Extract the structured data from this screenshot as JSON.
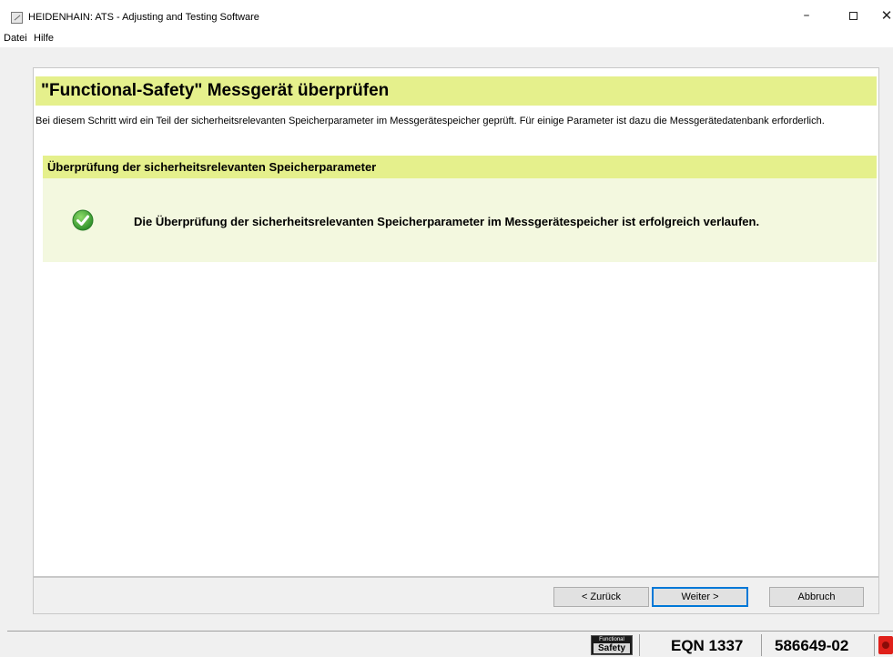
{
  "window": {
    "title": "HEIDENHAIN: ATS - Adjusting and Testing Software",
    "controls": {
      "minimize": "–",
      "close": "✕"
    }
  },
  "menu": {
    "datei": "Datei",
    "hilfe": "Hilfe"
  },
  "page": {
    "title": "\"Functional-Safety\" Messgerät überprüfen",
    "description": "Bei diesem Schritt wird ein Teil der sicherheitsrelevanten Speicherparameter im Messgerätespeicher geprüft. Für einige Parameter ist dazu die Messgerätedatenbank erforderlich.",
    "section_title": "Überprüfung der sicherheitsrelevanten Speicherparameter",
    "result_text": "Die Überprüfung der sicherheitsrelevanten Speicherparameter im Messgerätespeicher ist erfolgreich verlaufen.",
    "result_icon": "success-check-icon"
  },
  "buttons": {
    "back": "< Zurück",
    "next": "Weiter >",
    "cancel": "Abbruch"
  },
  "status": {
    "fs_logo_top": "Functional",
    "fs_logo_bottom": "Safety",
    "device": "EQN 1337",
    "id_number": "586649-02",
    "connection_icon": "red-status-indicator-icon"
  },
  "colors": {
    "header_bg": "#e5f08c",
    "result_bg": "#f3f8df",
    "success_green": "#3aa33a",
    "focus_blue": "#0078d7",
    "indicator_red": "#e0201a"
  }
}
